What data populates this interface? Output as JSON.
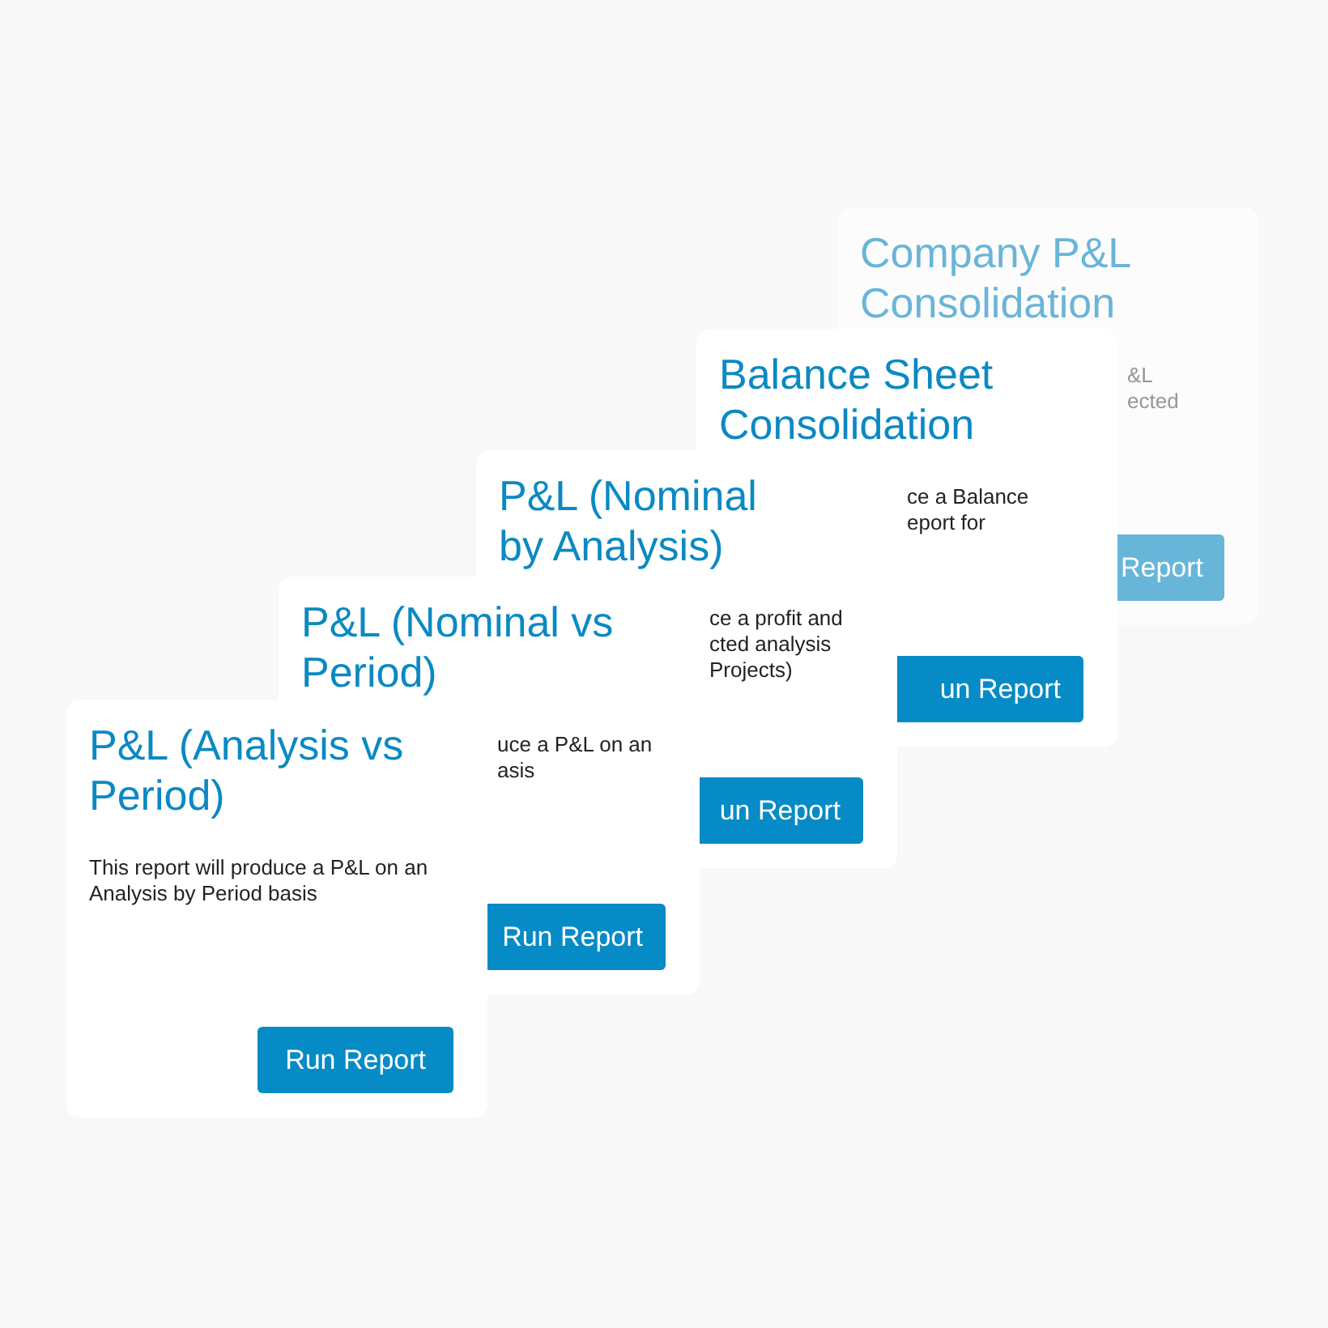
{
  "cards": [
    {
      "title": "Company P&L\nConsolidation",
      "description": "&L\nected",
      "button": "Report",
      "faded": true
    },
    {
      "title": "Balance Sheet\nConsolidation",
      "description": "ce a Balance\neport for",
      "button": "un Report",
      "faded": false
    },
    {
      "title": "P&L (Nominal\nby Analysis)",
      "description": "ce a profit and\ncted analysis\nProjects)",
      "button": "un Report",
      "faded": false
    },
    {
      "title": "P&L (Nominal vs\nPeriod)",
      "description": "uce a P&L on an\nasis",
      "button": "Run Report",
      "faded": false
    },
    {
      "title": "P&L (Analysis vs\nPeriod)",
      "description": "This report will produce a P&L on an\nAnalysis by Period basis",
      "button": "Run Report",
      "faded": false
    }
  ]
}
